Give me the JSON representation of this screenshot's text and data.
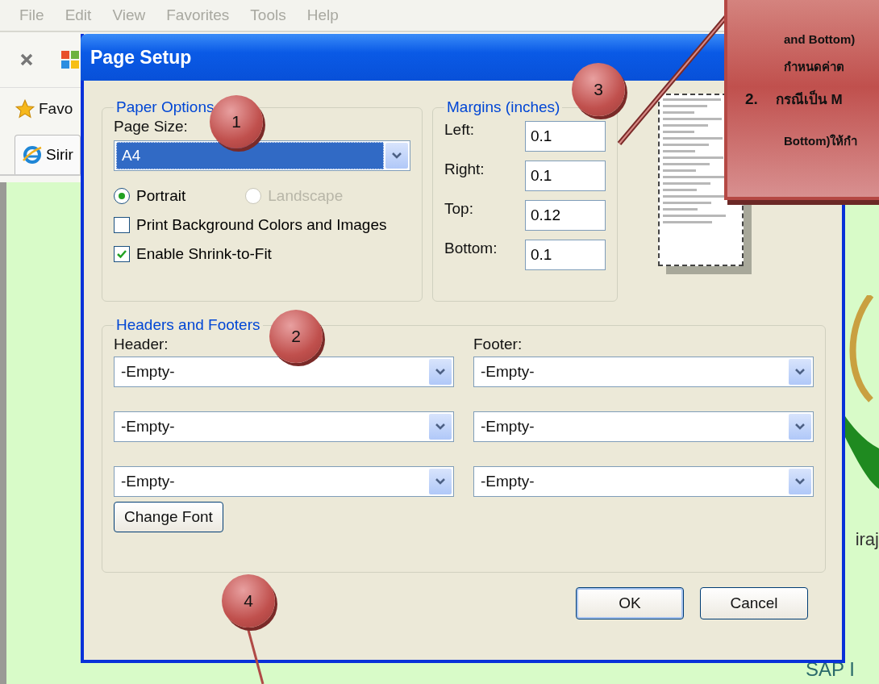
{
  "browser": {
    "menu": [
      "File",
      "Edit",
      "View",
      "Favorites",
      "Tools",
      "Help"
    ],
    "favorites_label": "Favo",
    "tab_label": "Sirir",
    "page_texts": [
      "iraj",
      "SAP I"
    ]
  },
  "dialog": {
    "title": "Page Setup",
    "paper_options": {
      "legend": "Paper Options",
      "page_size_label": "Page Size:",
      "page_size_value": "A4",
      "orientations": [
        {
          "label": "Portrait",
          "selected": true,
          "disabled": false
        },
        {
          "label": "Landscape",
          "selected": false,
          "disabled": true
        }
      ],
      "checkboxes": [
        {
          "label": "Print Background Colors and Images",
          "checked": false
        },
        {
          "label": "Enable Shrink-to-Fit",
          "checked": true
        }
      ]
    },
    "margins": {
      "legend": "Margins (inches)",
      "fields": [
        {
          "label": "Left:",
          "value": "0.1"
        },
        {
          "label": "Right:",
          "value": "0.1"
        },
        {
          "label": "Top:",
          "value": "0.12"
        },
        {
          "label": "Bottom:",
          "value": "0.1"
        }
      ]
    },
    "headers_footers": {
      "legend": "Headers and Footers",
      "header_label": "Header:",
      "footer_label": "Footer:",
      "headers": [
        "-Empty-",
        "-Empty-",
        "-Empty-"
      ],
      "footers": [
        "-Empty-",
        "-Empty-",
        "-Empty-"
      ],
      "change_font": "Change Font"
    },
    "buttons": [
      "OK",
      "Cancel"
    ]
  },
  "annotations": {
    "badges": [
      "1",
      "2",
      "3",
      "4"
    ],
    "callout": [
      {
        "text": "and Bottom)"
      },
      {
        "text": "กำหนดค่าต"
      },
      {
        "marker": "2.",
        "text": "กรณีเป็น M"
      },
      {
        "text": "Bottom)ให้กำ"
      }
    ]
  }
}
